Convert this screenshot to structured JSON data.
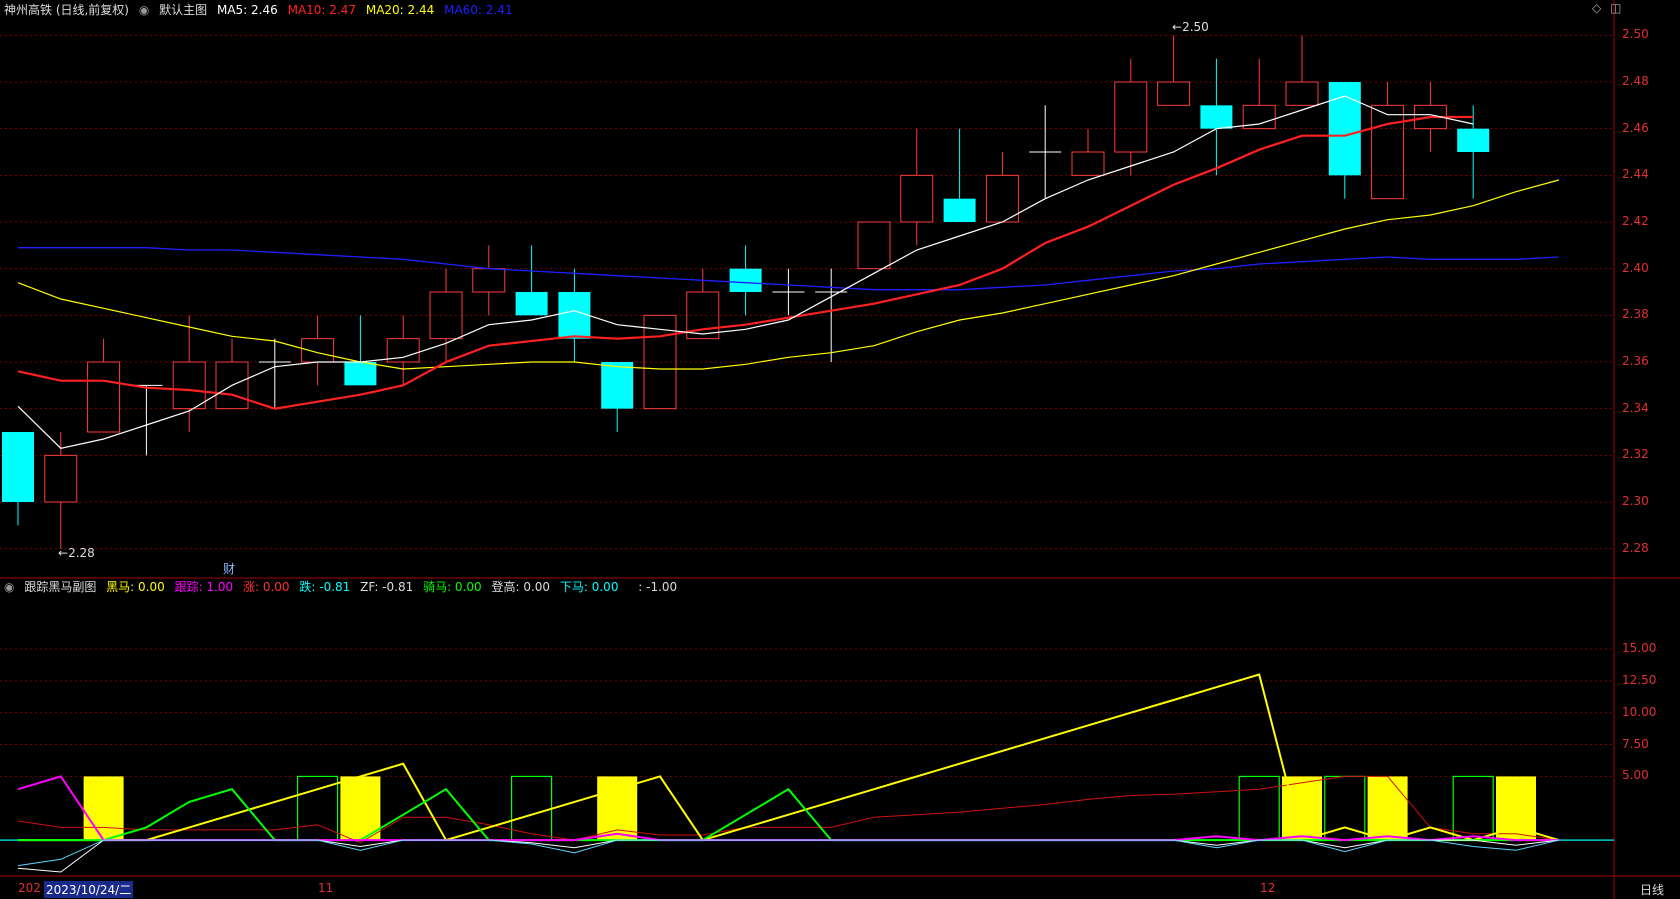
{
  "main_header": {
    "title": "神州高铁 (日线,前复权)",
    "menu_label": "默认主图",
    "ma5": "MA5: 2.46",
    "ma10": "MA10: 2.47",
    "ma20": "MA20: 2.44",
    "ma60": "MA60: 2.41"
  },
  "sub_header": {
    "title": "跟踪黑马副图",
    "heima": "黑马: 0.00",
    "genzong": "跟踪: 1.00",
    "zhang": "涨: 0.00",
    "die": "跌: -0.81",
    "zf": "ZF: -0.81",
    "qima": "骑马: 0.00",
    "denggao": "登高: 0.00",
    "xiama": "下马: 0.00",
    "blank": ": -1.00"
  },
  "annotations": {
    "high": "2.50",
    "low": "2.28",
    "cai": "财"
  },
  "footer": {
    "year_stub": "202",
    "date_cursor": "2023/10/24/二",
    "month_11": "11",
    "month_12": "12",
    "period_button": "日线"
  },
  "colors": {
    "up": "#ff3c3c",
    "down": "#00ffff",
    "ma5": "#ffffff",
    "ma10": "#ff2020",
    "ma20": "#ffff00",
    "ma60": "#2020ff",
    "grid": "#7a0000",
    "heima": "#ffff00",
    "genzong": "#ff00ff",
    "qima": "#00ff00"
  },
  "chart_data": [
    {
      "type": "candlestick",
      "ylim": [
        2.27,
        2.51
      ],
      "y_ticks": [
        "2.50",
        "2.48",
        "2.46",
        "2.44",
        "2.42",
        "2.40",
        "2.38",
        "2.36",
        "2.34",
        "2.32",
        "2.30",
        "2.28"
      ],
      "candles": [
        {
          "o": 2.33,
          "h": 2.33,
          "l": 2.29,
          "c": 2.3
        },
        {
          "o": 2.3,
          "h": 2.33,
          "l": 2.28,
          "c": 2.32
        },
        {
          "o": 2.33,
          "h": 2.37,
          "l": 2.33,
          "c": 2.36
        },
        {
          "o": 2.35,
          "h": 2.35,
          "l": 2.32,
          "c": 2.35
        },
        {
          "o": 2.34,
          "h": 2.38,
          "l": 2.33,
          "c": 2.36
        },
        {
          "o": 2.34,
          "h": 2.37,
          "l": 2.34,
          "c": 2.36
        },
        {
          "o": 2.36,
          "h": 2.37,
          "l": 2.34,
          "c": 2.36
        },
        {
          "o": 2.36,
          "h": 2.38,
          "l": 2.35,
          "c": 2.37
        },
        {
          "o": 2.36,
          "h": 2.38,
          "l": 2.35,
          "c": 2.35
        },
        {
          "o": 2.36,
          "h": 2.38,
          "l": 2.35,
          "c": 2.37
        },
        {
          "o": 2.37,
          "h": 2.4,
          "l": 2.36,
          "c": 2.39
        },
        {
          "o": 2.39,
          "h": 2.41,
          "l": 2.38,
          "c": 2.4
        },
        {
          "o": 2.39,
          "h": 2.41,
          "l": 2.38,
          "c": 2.38
        },
        {
          "o": 2.39,
          "h": 2.4,
          "l": 2.36,
          "c": 2.37
        },
        {
          "o": 2.36,
          "h": 2.36,
          "l": 2.33,
          "c": 2.34
        },
        {
          "o": 2.34,
          "h": 2.38,
          "l": 2.34,
          "c": 2.38
        },
        {
          "o": 2.37,
          "h": 2.4,
          "l": 2.37,
          "c": 2.39
        },
        {
          "o": 2.4,
          "h": 2.41,
          "l": 2.38,
          "c": 2.39
        },
        {
          "o": 2.39,
          "h": 2.4,
          "l": 2.38,
          "c": 2.39
        },
        {
          "o": 2.39,
          "h": 2.4,
          "l": 2.36,
          "c": 2.39
        },
        {
          "o": 2.4,
          "h": 2.42,
          "l": 2.4,
          "c": 2.42
        },
        {
          "o": 2.42,
          "h": 2.46,
          "l": 2.41,
          "c": 2.44
        },
        {
          "o": 2.43,
          "h": 2.46,
          "l": 2.42,
          "c": 2.42
        },
        {
          "o": 2.42,
          "h": 2.45,
          "l": 2.42,
          "c": 2.44
        },
        {
          "o": 2.45,
          "h": 2.47,
          "l": 2.43,
          "c": 2.45
        },
        {
          "o": 2.44,
          "h": 2.46,
          "l": 2.44,
          "c": 2.45
        },
        {
          "o": 2.45,
          "h": 2.49,
          "l": 2.44,
          "c": 2.48
        },
        {
          "o": 2.47,
          "h": 2.5,
          "l": 2.47,
          "c": 2.48
        },
        {
          "o": 2.47,
          "h": 2.49,
          "l": 2.44,
          "c": 2.46
        },
        {
          "o": 2.46,
          "h": 2.49,
          "l": 2.46,
          "c": 2.47
        },
        {
          "o": 2.47,
          "h": 2.5,
          "l": 2.47,
          "c": 2.48
        },
        {
          "o": 2.48,
          "h": 2.48,
          "l": 2.43,
          "c": 2.44
        },
        {
          "o": 2.43,
          "h": 2.48,
          "l": 2.43,
          "c": 2.47
        },
        {
          "o": 2.46,
          "h": 2.48,
          "l": 2.45,
          "c": 2.47
        },
        {
          "o": 2.46,
          "h": 2.47,
          "l": 2.43,
          "c": 2.45
        }
      ],
      "ma5": [
        2.341,
        2.323,
        2.327,
        2.333,
        2.339,
        2.35,
        2.358,
        2.36,
        2.36,
        2.362,
        2.368,
        2.376,
        2.378,
        2.382,
        2.376,
        2.374,
        2.372,
        2.374,
        2.378,
        2.388,
        2.398,
        2.408,
        2.414,
        2.42,
        2.43,
        2.438,
        2.444,
        2.45,
        2.46,
        2.462,
        2.468,
        2.474,
        2.466,
        2.466,
        2.462
      ],
      "ma10": [
        2.356,
        2.352,
        2.352,
        2.349,
        2.348,
        2.346,
        2.34,
        2.343,
        2.346,
        2.35,
        2.36,
        2.367,
        2.369,
        2.371,
        2.37,
        2.371,
        2.374,
        2.376,
        2.379,
        2.382,
        2.385,
        2.389,
        2.393,
        2.4,
        2.411,
        2.418,
        2.427,
        2.436,
        2.443,
        2.451,
        2.457,
        2.457,
        2.462,
        2.465,
        2.465
      ],
      "ma20": [
        2.394,
        2.387,
        2.383,
        2.379,
        2.375,
        2.371,
        2.369,
        2.364,
        2.36,
        2.357,
        2.358,
        2.359,
        2.36,
        2.36,
        2.358,
        2.357,
        2.357,
        2.359,
        2.362,
        2.364,
        2.367,
        2.373,
        2.378,
        2.381,
        2.385,
        2.389,
        2.393,
        2.397,
        2.402,
        2.407,
        2.412,
        2.417,
        2.421,
        2.423,
        2.427,
        2.433,
        2.438
      ],
      "ma60": [
        2.409,
        2.409,
        2.409,
        2.409,
        2.408,
        2.408,
        2.407,
        2.406,
        2.405,
        2.404,
        2.402,
        2.4,
        2.399,
        2.398,
        2.397,
        2.396,
        2.395,
        2.394,
        2.393,
        2.392,
        2.391,
        2.391,
        2.391,
        2.392,
        2.393,
        2.395,
        2.397,
        2.399,
        2.4,
        2.402,
        2.403,
        2.404,
        2.405,
        2.404,
        2.404,
        2.404,
        2.405
      ]
    },
    {
      "type": "indicator",
      "ylim": [
        -2.5,
        19
      ],
      "y_ticks": [
        "15.00",
        "12.50",
        "10.00",
        "7.50",
        "5.00"
      ],
      "heima_bars": [
        2,
        8,
        14,
        30,
        32,
        35
      ],
      "qima_boxes": [
        7,
        12,
        29,
        31,
        34
      ],
      "heima_line": [
        0,
        0,
        0,
        0,
        1,
        2,
        3,
        4,
        5,
        6,
        0,
        1,
        2,
        3,
        4,
        5,
        0,
        1,
        2,
        3,
        4,
        5,
        6,
        7,
        8,
        9,
        10,
        11,
        12,
        13,
        0,
        1,
        0,
        1,
        0,
        1,
        0
      ],
      "genzong_line": [
        4,
        5,
        0,
        0,
        0,
        0,
        0,
        0,
        0,
        0,
        0,
        0,
        0,
        0,
        0.5,
        0,
        0,
        0,
        0,
        0,
        0,
        0,
        0,
        0,
        0,
        0,
        0,
        0,
        0.3,
        0,
        0.3,
        0,
        0.3,
        0,
        0.3,
        0,
        0
      ],
      "qima_line": [
        0,
        0,
        0,
        1,
        3,
        4,
        0,
        0,
        0,
        2,
        4,
        0,
        0,
        0,
        0,
        0,
        0,
        2,
        4,
        0,
        0,
        0,
        0,
        0,
        0,
        0,
        0,
        0,
        0,
        0,
        0,
        0,
        0,
        0,
        0,
        0,
        0
      ],
      "red_line": [
        1.5,
        1.0,
        1.0,
        0.8,
        0.8,
        0.8,
        0.8,
        1.2,
        -0.2,
        1.8,
        1.8,
        1.2,
        0.5,
        0.0,
        0.8,
        0.4,
        0.4,
        1.0,
        1.0,
        1.0,
        1.8,
        2.0,
        2.2,
        2.5,
        2.8,
        3.2,
        3.5,
        3.6,
        3.8,
        4.0,
        4.5,
        5.0,
        5.0,
        1.0,
        0.5,
        0.5,
        0.0
      ],
      "zhang_line": [
        -2.2,
        -2.5,
        0,
        0,
        0,
        0,
        0,
        0,
        -0.5,
        0,
        0,
        0,
        -0.2,
        -0.6,
        0,
        0,
        0,
        0,
        0,
        0,
        0,
        0,
        0,
        0,
        0,
        0,
        0,
        0,
        -0.4,
        0,
        0,
        -0.6,
        0,
        0,
        0,
        -0.4,
        0
      ],
      "die_line": [
        -2.0,
        -1.5,
        0,
        0,
        0,
        0,
        0,
        0,
        -0.8,
        0,
        0,
        0,
        -0.3,
        -1.0,
        0,
        0,
        0,
        0,
        0,
        0,
        0,
        0,
        0,
        0,
        0,
        0,
        0,
        0,
        -0.6,
        0,
        0,
        -0.9,
        0,
        0,
        -0.5,
        -0.8,
        0
      ]
    }
  ]
}
